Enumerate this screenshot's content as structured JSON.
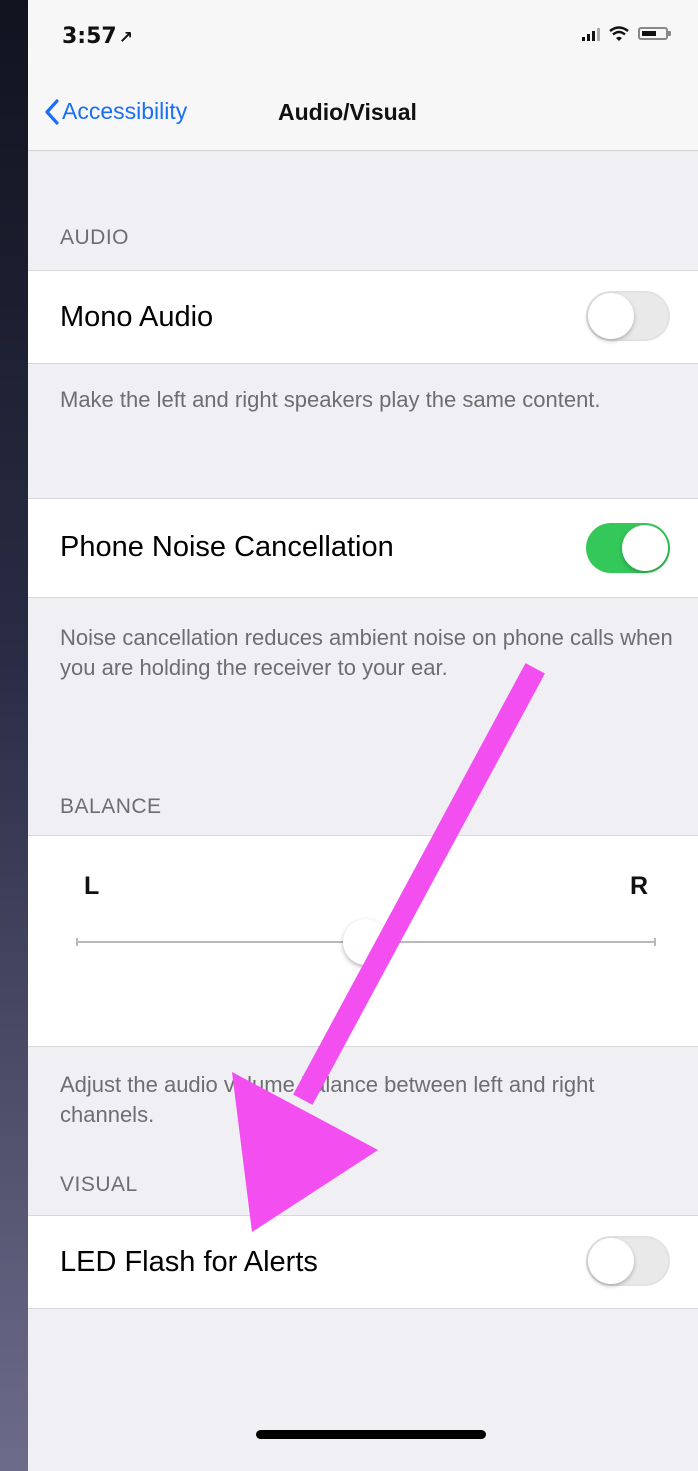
{
  "status_bar": {
    "time": "3:57",
    "location_glyph": "↗"
  },
  "nav": {
    "back_label": "Accessibility",
    "title": "Audio/Visual"
  },
  "sections": {
    "audio_header": "AUDIO",
    "balance_header": "BALANCE",
    "visual_header": "VISUAL"
  },
  "mono_audio": {
    "label": "Mono Audio",
    "enabled": false,
    "footer": "Make the left and right speakers play the same content."
  },
  "noise_cancellation": {
    "label": "Phone Noise Cancellation",
    "enabled": true,
    "footer": "Noise cancellation reduces ambient noise on phone calls when you are holding the receiver to your ear."
  },
  "balance": {
    "left_label": "L",
    "right_label": "R",
    "value": 0.5,
    "footer": "Adjust the audio volume balance between left and right channels."
  },
  "led_flash": {
    "label": "LED Flash for Alerts",
    "enabled": false
  },
  "colors": {
    "accent": "#1a6ff7",
    "switch_on": "#34c759",
    "annotation_arrow": "#f24ef0"
  },
  "icons": [
    "chevron-left-icon",
    "signal-icon",
    "wifi-icon",
    "battery-icon",
    "location-arrow-icon",
    "arrow-annotation-icon"
  ]
}
